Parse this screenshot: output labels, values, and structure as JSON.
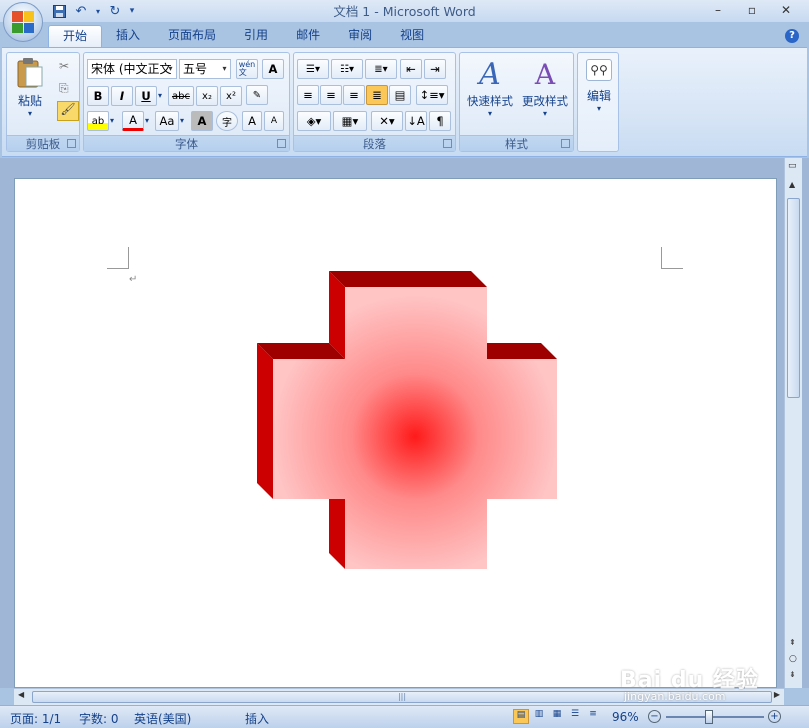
{
  "window": {
    "title": "文档 1 - Microsoft Word",
    "controls": {
      "minimize": "–",
      "maximize": "▫",
      "close": "✕"
    }
  },
  "qat": {
    "save_icon": "save-icon",
    "undo_icon": "undo-icon",
    "redo_icon": "redo-icon"
  },
  "tabs": [
    {
      "label": "开始",
      "active": true
    },
    {
      "label": "插入"
    },
    {
      "label": "页面布局"
    },
    {
      "label": "引用"
    },
    {
      "label": "邮件"
    },
    {
      "label": "审阅"
    },
    {
      "label": "视图"
    }
  ],
  "help": "?",
  "ribbon": {
    "clipboard": {
      "label": "剪贴板",
      "paste": "粘贴"
    },
    "font": {
      "label": "字体",
      "font_name": "宋体 (中文正文",
      "font_size": "五号",
      "bold": "B",
      "italic": "I",
      "underline": "U",
      "strike": "abc",
      "subscript": "x₂",
      "superscript": "x²",
      "grow": "A",
      "shrink": "A",
      "wen": "wén\n文",
      "char_border": "A",
      "highlight": "ab",
      "font_color": "A",
      "case": "Aa",
      "shading": "A",
      "enclose": "字"
    },
    "paragraph": {
      "label": "段落"
    },
    "styles": {
      "label": "样式",
      "quick_styles": "快速样式",
      "change_styles": "更改样式"
    },
    "editing": {
      "label": "编辑"
    }
  },
  "document": {
    "para_mark": "↵"
  },
  "colors": {
    "cross_face_center": "#ff1a1a",
    "cross_face_edge": "#ffc4c4",
    "cross_side": "#cc0000",
    "cross_top": "#9e0000"
  },
  "statusbar": {
    "page": "页面: 1/1",
    "words": "字数: 0",
    "language": "英语(美国)",
    "mode": "插入",
    "zoom": "96%"
  },
  "watermark": {
    "brand": "Bai du 经验",
    "url": "jingyan.baidu.com"
  }
}
